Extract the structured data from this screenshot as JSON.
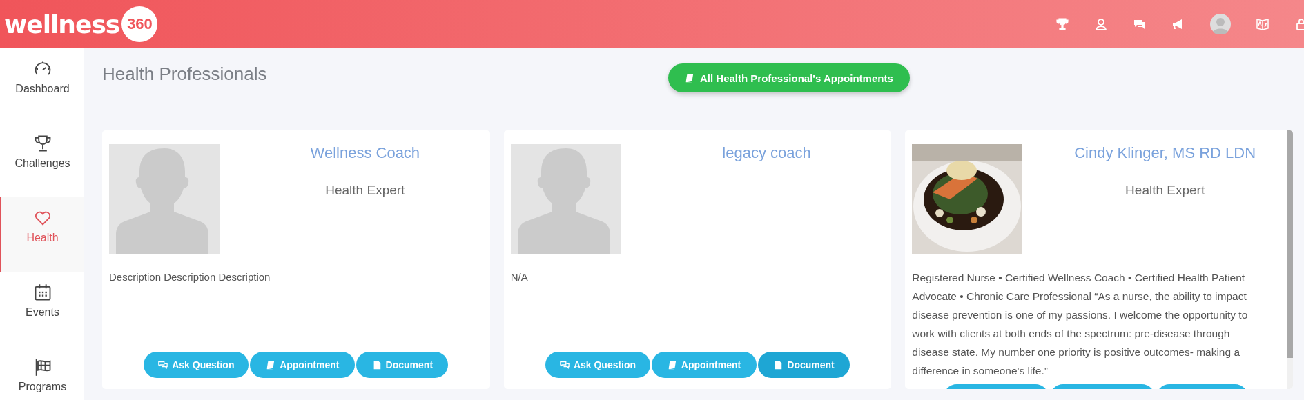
{
  "header": {
    "logo_word": "wellness",
    "logo_number": "360",
    "icons": [
      {
        "kind": "trophy"
      },
      {
        "kind": "coach"
      },
      {
        "kind": "chat"
      },
      {
        "kind": "megaphone"
      },
      {
        "kind": "avatar"
      },
      {
        "kind": "translate"
      },
      {
        "kind": "lock"
      }
    ]
  },
  "sidebar": {
    "items": [
      {
        "label": "Dashboard",
        "kind": "gauge",
        "selected": false
      },
      {
        "label": "Challenges",
        "kind": "trophy",
        "selected": false
      },
      {
        "label": "Health",
        "kind": "heart",
        "selected": true
      },
      {
        "label": "Events",
        "kind": "calendar",
        "selected": false
      },
      {
        "label": "Programs",
        "kind": "flag",
        "selected": false
      }
    ]
  },
  "page": {
    "title": "Health Professionals",
    "action_button": "All Health Professional's Appointments"
  },
  "cards": [
    {
      "name": "Wellness Coach",
      "role": "Health Expert",
      "kind": "placeholder",
      "description": "Description Description Description",
      "scrollbar": false,
      "buttons": [
        {
          "kind": "ask",
          "label": "Ask Question",
          "highlighted": false
        },
        {
          "kind": "appointment",
          "label": "Appointment",
          "highlighted": false
        },
        {
          "kind": "document",
          "label": "Document",
          "highlighted": false
        }
      ]
    },
    {
      "name": "legacy coach",
      "kind": "placeholder",
      "description": "N/A",
      "scrollbar": false,
      "buttons": [
        {
          "kind": "ask",
          "label": "Ask Question",
          "highlighted": false
        },
        {
          "kind": "appointment",
          "label": "Appointment",
          "highlighted": false
        },
        {
          "kind": "document",
          "label": "Document",
          "highlighted": true
        }
      ]
    },
    {
      "name": "Cindy Klinger, MS RD LDN",
      "role": "Health Expert",
      "description": "Registered Nurse • Certified Wellness Coach • Certified Health Patient Advocate • Chronic Care Professional “As a nurse, the ability to impact disease prevention is one of my passions. I welcome the opportunity to work with clients at both ends of the spectrum: pre-disease through disease state. My number one priority is positive outcomes- making a difference in someone's life.”",
      "scrollbar": true,
      "buttons": [
        {
          "kind": "ask",
          "highlighted": false
        },
        {
          "kind": "appointment",
          "highlighted": false
        },
        {
          "kind": "document",
          "highlighted": false
        }
      ]
    }
  ]
}
